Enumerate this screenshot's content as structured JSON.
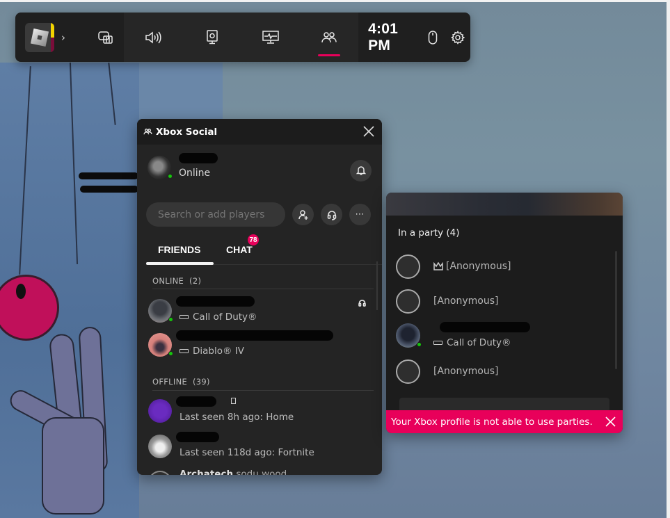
{
  "gamebar": {
    "active_app": "Roblox",
    "widgets": [
      {
        "name": "widget-menu",
        "icon": "widget-store-icon"
      },
      {
        "name": "audio",
        "icon": "speaker-icon"
      },
      {
        "name": "capture",
        "icon": "capture-icon"
      },
      {
        "name": "performance",
        "icon": "performance-monitor-icon"
      },
      {
        "name": "xbox-social",
        "icon": "people-icon",
        "active": true
      }
    ],
    "clock": "4:01 PM",
    "right_icons": [
      "mouse-icon",
      "gear-icon"
    ],
    "accent_color": "#e8005a"
  },
  "social": {
    "title": "Xbox Social",
    "me": {
      "gamertag": "[redacted]",
      "status": "Online"
    },
    "search_placeholder": "Search or add players",
    "tabs": [
      {
        "label": "FRIENDS",
        "active": true
      },
      {
        "label": "CHAT",
        "badge": "78"
      }
    ],
    "online_label": "ONLINE",
    "online_count": "(2)",
    "online_friends": [
      {
        "gamertag": "[redacted]",
        "activity": "Call of Duty®",
        "in_voice": true
      },
      {
        "gamertag": "[redacted]",
        "activity": "Diablo® IV",
        "in_voice": false
      }
    ],
    "offline_label": "OFFLINE",
    "offline_count": "(39)",
    "offline_friends": [
      {
        "gamertag": "[redacted]",
        "activity": "Last seen 8h ago: Home"
      },
      {
        "gamertag": "[redacted]",
        "activity": "Last seen 118d ago: Fortnite"
      },
      {
        "gamertag": "Archatech",
        "activity": "sodu.wood"
      }
    ]
  },
  "party": {
    "title": "In a party (4)",
    "members": [
      {
        "name": "[Anonymous]",
        "leader": true
      },
      {
        "name": "[Anonymous]",
        "leader": false
      },
      {
        "name": "[redacted]",
        "activity": "Call of Duty®",
        "online": true
      },
      {
        "name": "[Anonymous]",
        "leader": false
      }
    ],
    "toast": "Your Xbox profile is not able to use parties."
  }
}
